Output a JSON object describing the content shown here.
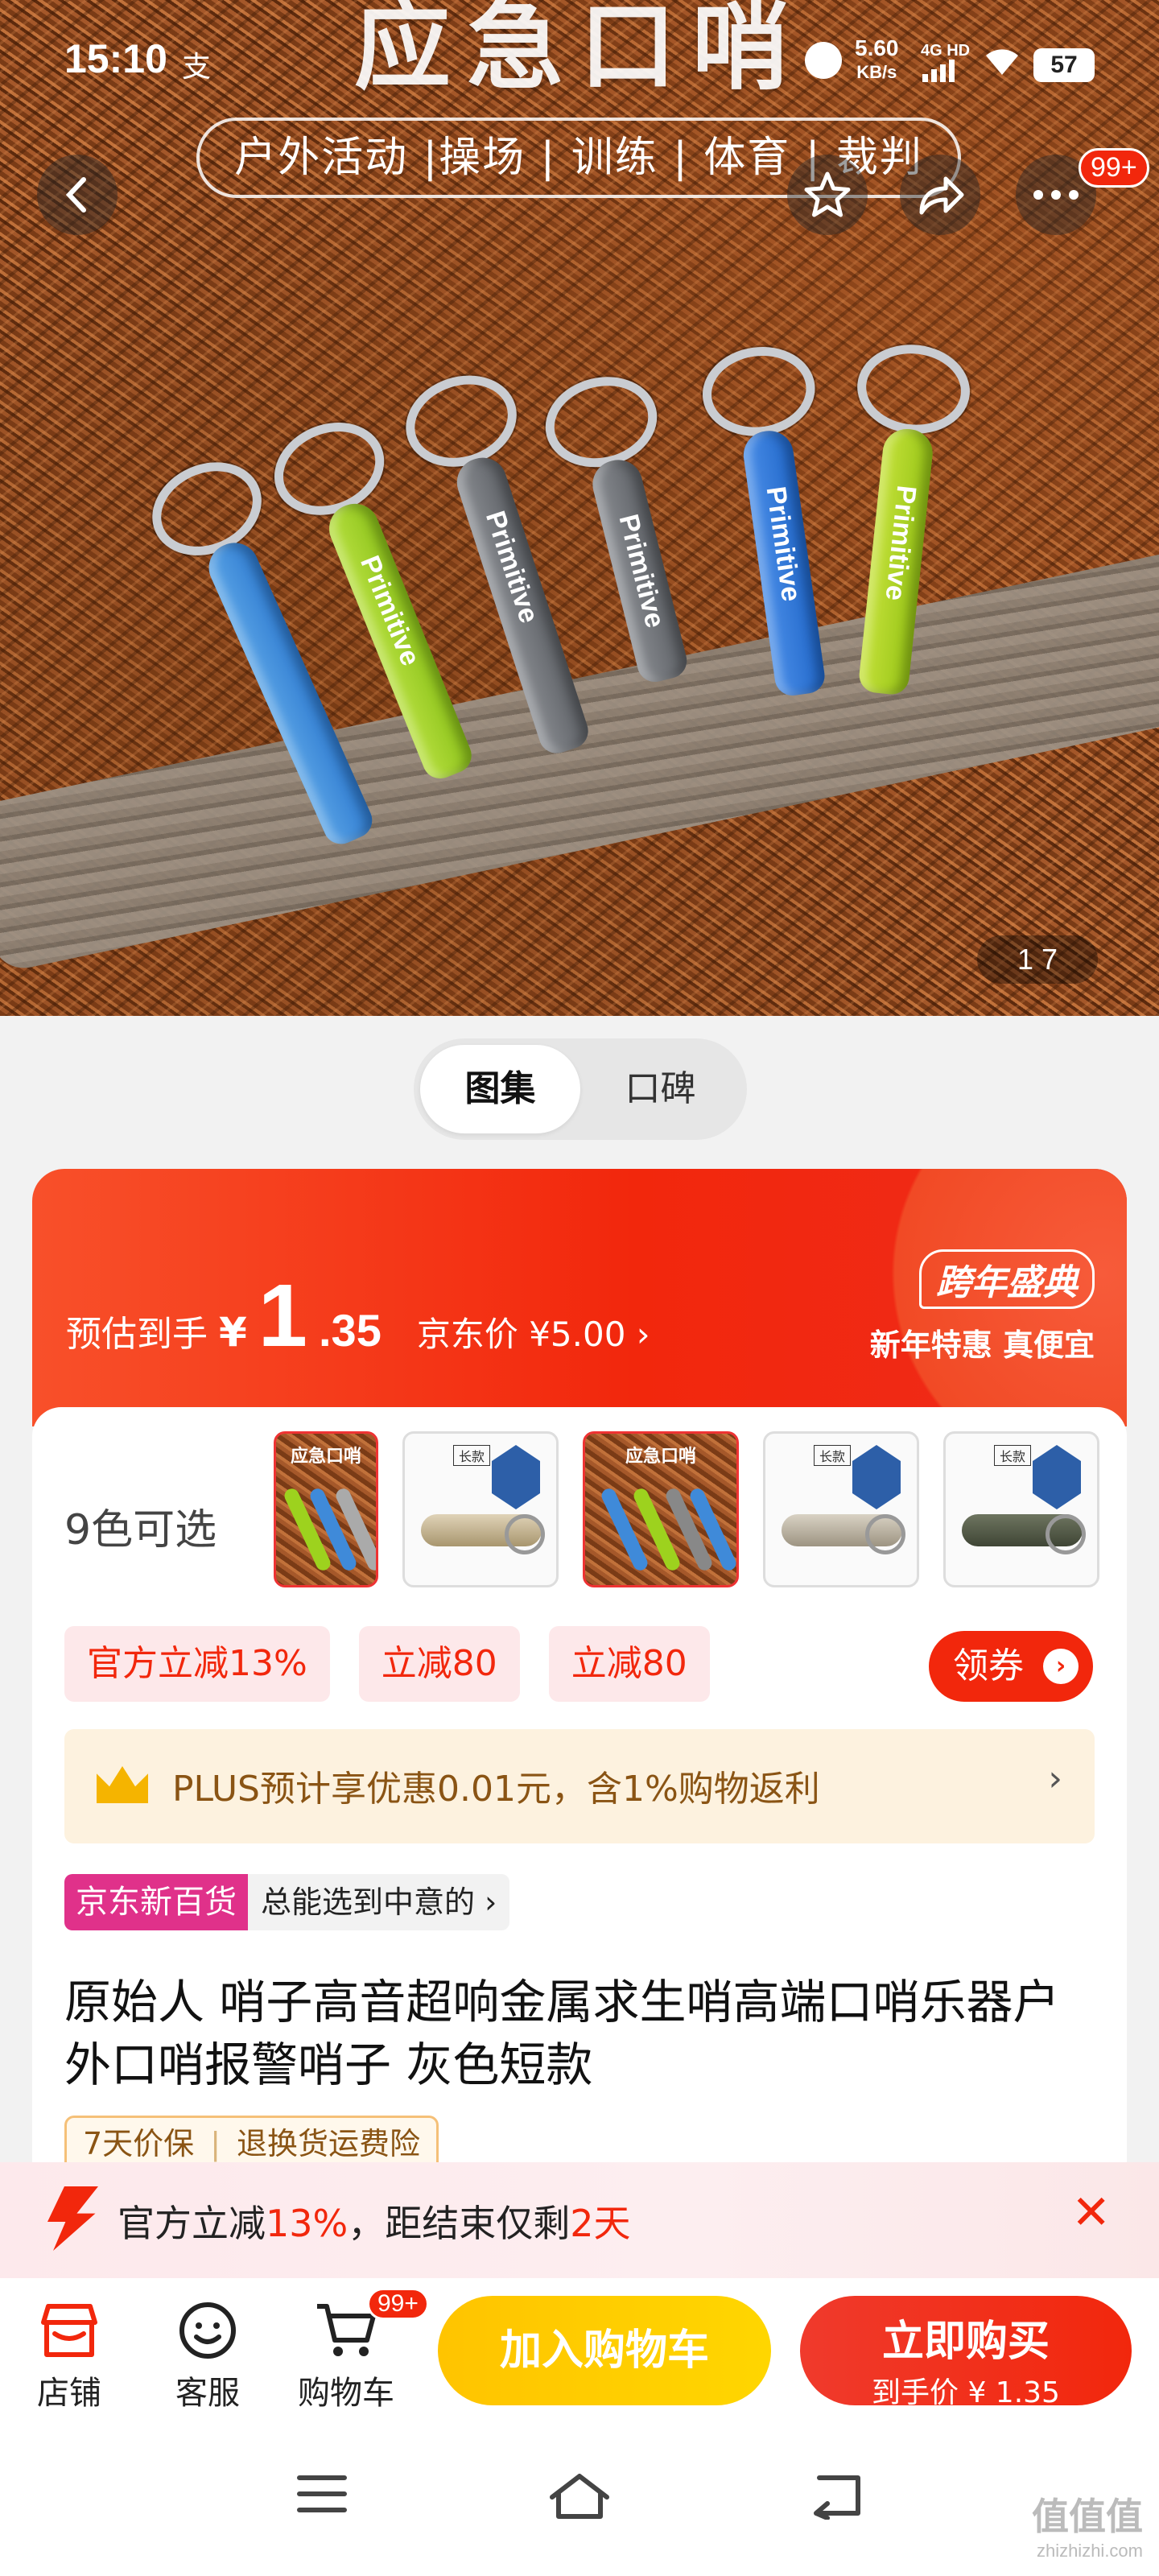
{
  "status_bar": {
    "time": "15:10",
    "pay_glyph": "支",
    "speed_value": "5.60",
    "speed_unit": "KB/s",
    "network": "4G HD",
    "battery": "57"
  },
  "hero": {
    "title": "应急口哨",
    "subtitle": "户外活动 |操场 | 训练 | 体育 | 裁判",
    "whistle_brand": "Primitive",
    "more_badge": "99+",
    "pager": "1  7"
  },
  "tabs": [
    {
      "label": "图集",
      "active": true
    },
    {
      "label": "口碑",
      "active": false
    }
  ],
  "price": {
    "estimate_label": "预估到手",
    "currency": "¥",
    "integer": "1",
    "decimal": ".35",
    "jd_price_label": "京东价 ¥5.00 ›",
    "promo_title": "跨年盛典",
    "promo_sub": "新年特惠 真便宜"
  },
  "colors": {
    "label": "9色可选",
    "thumb_title": "应急口哨",
    "thumb_tag": "长款"
  },
  "chips": [
    "官方立减13%",
    "立减80",
    "立减80"
  ],
  "coupon_button": "领券",
  "plus_bar": {
    "text": "PLUS预计享优惠0.01元，含1%购物返利",
    "chevron": "›"
  },
  "store_tag": {
    "badge": "京东新百货",
    "slogan": "总能选到中意的 ›"
  },
  "product_title": "原始人 哨子高音超响金属求生哨高端口哨乐器户外口哨报警哨子 灰色短款",
  "guarantee": [
    "7天价保",
    "退换货运费险"
  ],
  "notice": {
    "prefix": "官方立减",
    "percent": "13%",
    "middle": "，距结束仅剩",
    "days": "2天",
    "close": "✕"
  },
  "action_bar": {
    "store": "店铺",
    "service": "客服",
    "cart": "购物车",
    "cart_badge": "99+",
    "add_to_cart": "加入购物车",
    "buy_now": "立即购买",
    "buy_price": "到手价 ¥ 1.35"
  },
  "watermark": {
    "text": "值值值",
    "url": "zhizhizhi.com"
  },
  "colors_theme": {
    "jd_red": "#f2270c",
    "cart_yellow": "#ffc400",
    "plus_gold": "#8a5414"
  }
}
